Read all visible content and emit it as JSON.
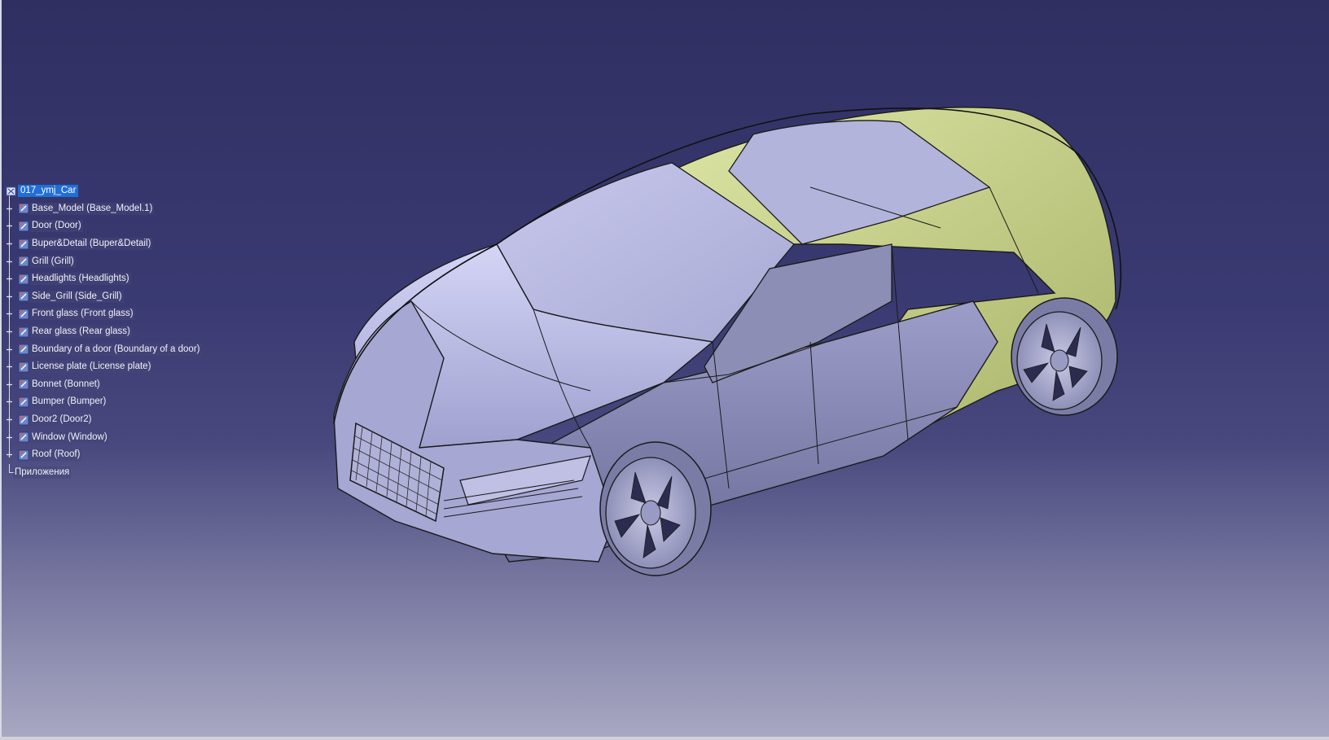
{
  "tree": {
    "root_label": "017_ymj_Car",
    "items": [
      {
        "label": "Base_Model (Base_Model.1)"
      },
      {
        "label": "Door (Door)"
      },
      {
        "label": "Buper&Detail (Buper&Detail)"
      },
      {
        "label": "Grill (Grill)"
      },
      {
        "label": "Headlights (Headlights)"
      },
      {
        "label": "Side_Grill (Side_Grill)"
      },
      {
        "label": "Front glass (Front glass)"
      },
      {
        "label": "Rear glass (Rear glass)"
      },
      {
        "label": "Boundary of a door (Boundary of a door)"
      },
      {
        "label": "License plate (License plate)"
      },
      {
        "label": "Bonnet (Bonnet)"
      },
      {
        "label": "Bumper (Bumper)"
      },
      {
        "label": "Door2 (Door2)"
      },
      {
        "label": "Window (Window)"
      },
      {
        "label": "Roof (Roof)"
      }
    ],
    "applications_label": "Приложения"
  },
  "colors": {
    "background_top": "#2f2f62",
    "background_bottom": "#a9a9c3",
    "body_surface": "#b8b9e2",
    "roof_surface": "#d6df9e",
    "selection": "#1f6fd8"
  },
  "icons": {
    "product_node": "product-icon",
    "part_node": "part-icon",
    "expander": "plus-expander-icon"
  }
}
